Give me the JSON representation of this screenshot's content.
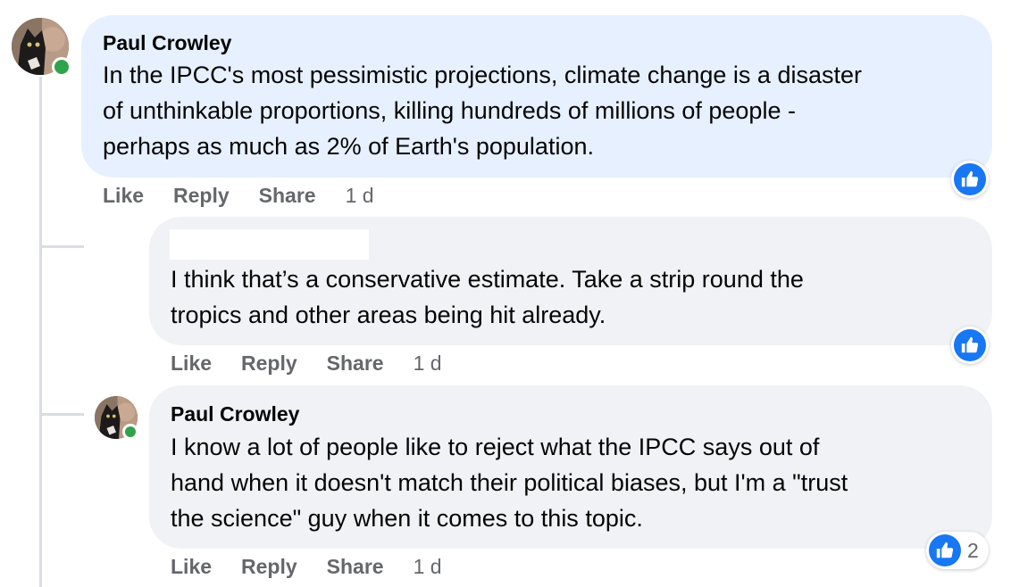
{
  "comments": [
    {
      "author": "Paul Crowley",
      "lines": [
        "In the IPCC's most pessimistic projections, climate change is a disaster",
        "of unthinkable proportions, killing hundreds of millions of people -",
        "perhaps as much as 2% of Earth's population."
      ],
      "actions": {
        "like": "Like",
        "reply": "Reply",
        "share": "Share",
        "time": "1 d"
      },
      "reaction_icon": "like-icon",
      "highlighted": true,
      "online": true
    },
    {
      "author": "",
      "lines": [
        "I think that’s a conservative estimate. Take a strip round the",
        "tropics and other areas being hit already."
      ],
      "actions": {
        "like": "Like",
        "reply": "Reply",
        "share": "Share",
        "time": "1 d"
      },
      "reaction_icon": "like-icon"
    },
    {
      "author": "Paul Crowley",
      "lines": [
        "I know a lot of people like to reject what the IPCC says out of",
        "hand when it doesn't match their political biases, but I'm a \"trust",
        "the science\" guy when it comes to this topic."
      ],
      "actions": {
        "like": "Like",
        "reply": "Reply",
        "share": "Share",
        "time": "1 d"
      },
      "reaction_icon": "like-icon",
      "reaction_count": "2",
      "online": true
    }
  ],
  "colors": {
    "highlight_bubble": "#e7f0fe",
    "bubble": "#f0f2f5",
    "like_blue": "#1877f2",
    "online_green": "#31a24c",
    "meta_gray": "#65676b"
  }
}
